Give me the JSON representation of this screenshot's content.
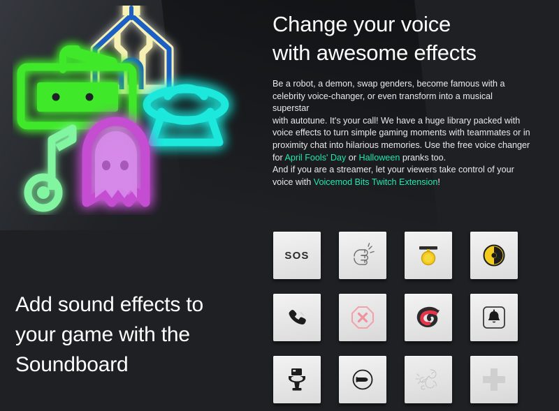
{
  "page": {
    "background_color": "#1e2023",
    "accent_link_color": "#21e8b0"
  },
  "hero": {
    "title": "Change your voice\nwith awesome effects",
    "paragraph_lines": [
      "Be a robot, a demon, swap genders, become famous with a",
      "celebrity voice-changer, or even transform into a musical superstar",
      "with autotune. It's your call! We have a huge library packed with",
      "voice effects to turn simple gaming moments with teammates or in",
      "proximity chat into hilarious memories. Use the free voice changer",
      "And if you are a streamer, let your viewers take control of your"
    ],
    "line_for_prefix": "for ",
    "link_april": "April Fools' Day",
    "between_links": " or ",
    "link_halloween": "Halloween",
    "after_halloween": " pranks too.",
    "voice_with_prefix": "voice with ",
    "link_voicemod": "Voicemod Bits Twitch Extension",
    "after_voicemod": "!"
  },
  "soundboard": {
    "heading": "Add sound effects to\nyour game with the\nSoundboard",
    "pads": [
      {
        "id": "sos",
        "name": "pad-sos",
        "label": "SOS",
        "icon": "sos-text",
        "kind": "text"
      },
      {
        "id": "knock",
        "name": "pad-knock",
        "label": "",
        "icon": "knocking-fist-icon",
        "kind": "svg"
      },
      {
        "id": "medal",
        "name": "pad-medal",
        "label": "",
        "icon": "gold-medal-icon",
        "kind": "svg",
        "color": "#f2cb1d"
      },
      {
        "id": "radiation",
        "name": "pad-radiation",
        "label": "",
        "icon": "radiation-icon",
        "kind": "svg",
        "color": "#f2cb1d"
      },
      {
        "id": "phone",
        "name": "pad-phone-ring",
        "label": "",
        "icon": "telephone-icon",
        "kind": "svg",
        "color": "#1c1c1c"
      },
      {
        "id": "stop",
        "name": "pad-stop-error",
        "label": "",
        "icon": "octagon-x-icon",
        "kind": "svg",
        "color": "#f2a2ad"
      },
      {
        "id": "swirl",
        "name": "pad-swirl",
        "label": "",
        "icon": "red-swirl-icon",
        "kind": "svg",
        "color": "#e8344a"
      },
      {
        "id": "bell",
        "name": "pad-doorbell",
        "label": "",
        "icon": "bell-icon",
        "kind": "svg",
        "color": "#1c1c1c"
      },
      {
        "id": "toilet",
        "name": "pad-toilet-flush",
        "label": "",
        "icon": "toilet-icon",
        "kind": "svg",
        "color": "#1c1c1c"
      },
      {
        "id": "bullet",
        "name": "pad-bullet",
        "label": "",
        "icon": "circled-bullet-icon",
        "kind": "svg",
        "color": "#1c1c1c"
      },
      {
        "id": "doodle",
        "name": "pad-doodle-sketch",
        "label": "",
        "icon": "line-doodle-icon",
        "kind": "svg",
        "color": "#c9c9c9"
      },
      {
        "id": "plus",
        "name": "pad-add",
        "label": "",
        "icon": "plus-cross-icon",
        "kind": "svg",
        "color": "#d0d0d0"
      }
    ]
  },
  "illustration": {
    "name": "neon-sticker-collage",
    "items": [
      {
        "name": "neon-radio-icon",
        "color": "#3fe82b"
      },
      {
        "name": "neon-church-icon",
        "color": "#f6efb0",
        "secondary": "#1f5fc4"
      },
      {
        "name": "neon-ufo-icon",
        "color": "#1fe8dc"
      },
      {
        "name": "neon-ghost-icon",
        "color": "#c44ed2",
        "secondary": "#d68ae8"
      },
      {
        "name": "neon-music-note-icon",
        "color": "#82f5a0"
      }
    ]
  }
}
